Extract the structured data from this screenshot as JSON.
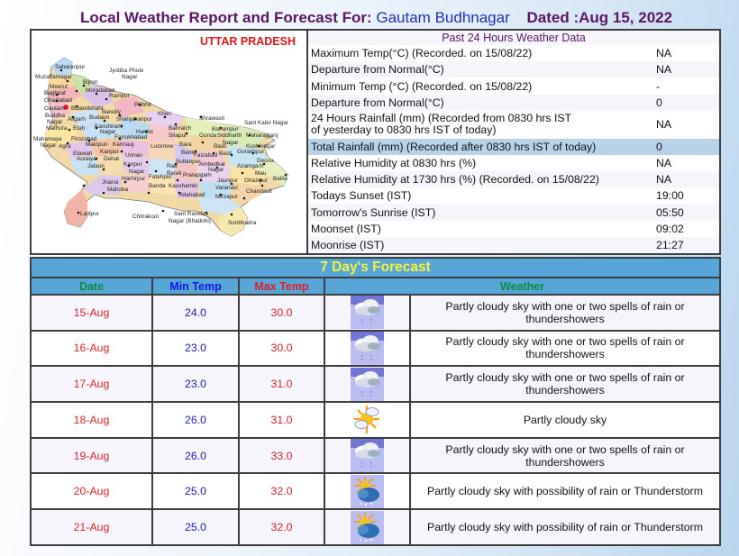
{
  "header": {
    "prefix": "Local Weather Report and Forecast For:",
    "location": "Gautam Budhnagar",
    "dated": "Dated :Aug 15, 2022"
  },
  "map": {
    "title": "UTTAR PRADESH",
    "highlight_color": "#e0141b",
    "districts": [
      "Saharanpur",
      "Muzaffarnagar",
      "Jyotiba Phule Nagar",
      "Bijnor",
      "Meerut",
      "Moradabad",
      "Baghpat",
      "Rampur",
      "Ghaziabad",
      "Pilibhit",
      "Gautam Buddha Nagar",
      "Bulandshahr",
      "Bareilly",
      "Kheri",
      "Aligarh",
      "Budaun",
      "Shahjahanpur",
      "Shrawasti",
      "Mathura",
      "Etah",
      "Kanshiram Nagar",
      "Sant Kabir Nagar",
      "Bahraich",
      "Balrampur",
      "Mahamaya Nagar",
      "Firozabad",
      "Hardoi",
      "Sitapur",
      "Siddharth Nagar",
      "Maharajganj",
      "Agra",
      "Mainpuri",
      "Farrukhabad",
      "Gonda",
      "Kushinagar",
      "Kannauj",
      "Lucknow",
      "Bara Banki",
      "Basti",
      "Etawah",
      "Kanpur",
      "Unnao",
      "Faizabad",
      "Gorakhpur",
      "Auraiya",
      "Dehat",
      "Sultanpur",
      "Ambedkar Nagar",
      "Deoria",
      "Jalaun",
      "Kanpur Nagar",
      "Rae Bareli",
      "Azamgarh",
      "Mau",
      "Ballia",
      "Jhansi",
      "Hamirpur",
      "Fatehpur",
      "Pratapgarh",
      "Jaunpur",
      "Ghazipur",
      "Mahoba",
      "Banda",
      "Kaushambi",
      "Allahabad",
      "Varanasi",
      "Chandauli",
      "Lalitpur",
      "Chitrakoot",
      "Sant Ravidas Nagar (Bhadohi)",
      "Mirzapur",
      "Sonbhadra"
    ]
  },
  "past24": {
    "title": "Past 24 Hours Weather Data",
    "rows": [
      {
        "label": "Maximum Temp(°C) (Recorded. on 15/08/22)",
        "value": "NA"
      },
      {
        "label": "Departure from Normal(°C)",
        "value": "NA"
      },
      {
        "label": "Minimum Temp (°C) (Recorded. on 15/08/22)",
        "value": "-"
      },
      {
        "label": "Departure from Normal(°C)",
        "value": "0"
      },
      {
        "label": "24 Hours Rainfall (mm) (Recorded from 0830 hrs IST",
        "label2": "of yesterday to 0830 hrs IST of today)",
        "value": "NA"
      },
      {
        "label": "Total Rainfall (mm) (Recorded after 0830 hrs IST of today)",
        "value": "0"
      },
      {
        "label": "Relative Humidity at 0830 hrs (%)",
        "value": "NA"
      },
      {
        "label": "Relative Humidity at 1730 hrs (%) (Recorded. on 15/08/22)",
        "value": "NA"
      },
      {
        "label": "Todays Sunset (IST)",
        "value": "19:00"
      },
      {
        "label": "Tomorrow's Sunrise (IST)",
        "value": "05:50"
      },
      {
        "label": "Moonset (IST)",
        "value": "09:02"
      },
      {
        "label": "Moonrise (IST)",
        "value": "21:27"
      }
    ]
  },
  "forecast": {
    "title": "7 Day's Forecast",
    "columns": {
      "date": "Date",
      "min": "Min Temp",
      "max": "Max Temp",
      "weather": "Weather"
    },
    "rows": [
      {
        "date": "15-Aug",
        "min": "24.0",
        "max": "30.0",
        "icon": "rain-cloud-icon",
        "weather": "Partly cloudy sky with one or two spells of rain or thundershowers"
      },
      {
        "date": "16-Aug",
        "min": "23.0",
        "max": "30.0",
        "icon": "rain-cloud-icon",
        "weather": "Partly cloudy sky with one or two spells of rain or thundershowers"
      },
      {
        "date": "17-Aug",
        "min": "23.0",
        "max": "31.0",
        "icon": "rain-cloud-icon",
        "weather": "Partly cloudy sky with one or two spells of rain or thundershowers"
      },
      {
        "date": "18-Aug",
        "min": "26.0",
        "max": "31.0",
        "icon": "sun-cloud-icon",
        "weather": "Partly cloudy sky"
      },
      {
        "date": "19-Aug",
        "min": "26.0",
        "max": "33.0",
        "icon": "rain-cloud-icon",
        "weather": "Partly cloudy sky with one or two spells of rain or thundershowers"
      },
      {
        "date": "20-Aug",
        "min": "25.0",
        "max": "32.0",
        "icon": "sun-storm-cloud-icon",
        "weather": "Partly cloudy sky with possibility of rain or Thunderstorm"
      },
      {
        "date": "21-Aug",
        "min": "25.0",
        "max": "32.0",
        "icon": "sun-storm-cloud-icon",
        "weather": "Partly cloudy sky with possibility of rain or Thunderstorm"
      }
    ]
  }
}
